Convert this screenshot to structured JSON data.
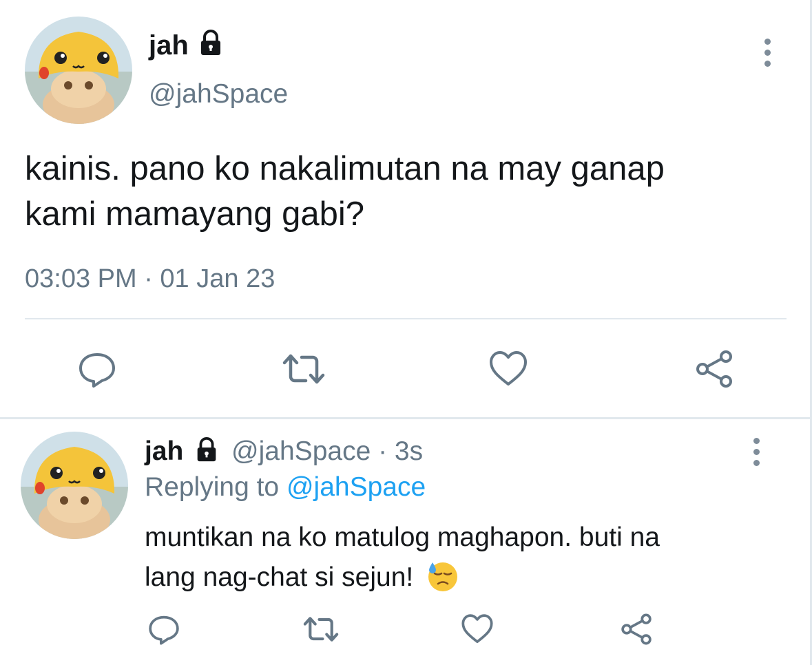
{
  "main_tweet": {
    "display_name": "jah",
    "handle": "@jahSpace",
    "text_line1": "kainis. pano ko nakalimutan na may ganap",
    "text_line2": "kami mamayang gabi?",
    "timestamp": "03:03 PM · 01 Jan 23",
    "actions": {
      "reply_icon": "reply-icon",
      "retweet_icon": "retweet-icon",
      "like_icon": "like-icon",
      "share_icon": "share-icon"
    }
  },
  "reply_tweet": {
    "display_name": "jah",
    "handle_time": "@jahSpace · 3s",
    "replying_to_label": "Replying to",
    "replying_to_handle": "@jahSpace",
    "text_line1": "muntikan na ko matulog maghapon. buti na",
    "text_line2": "lang nag-chat si sejun!",
    "emoji": "downcast-face-with-sweat-emoji"
  },
  "colors": {
    "text": "#14171a",
    "muted": "#657786",
    "accent": "#1da1f2",
    "divider": "#e1e8ed"
  }
}
